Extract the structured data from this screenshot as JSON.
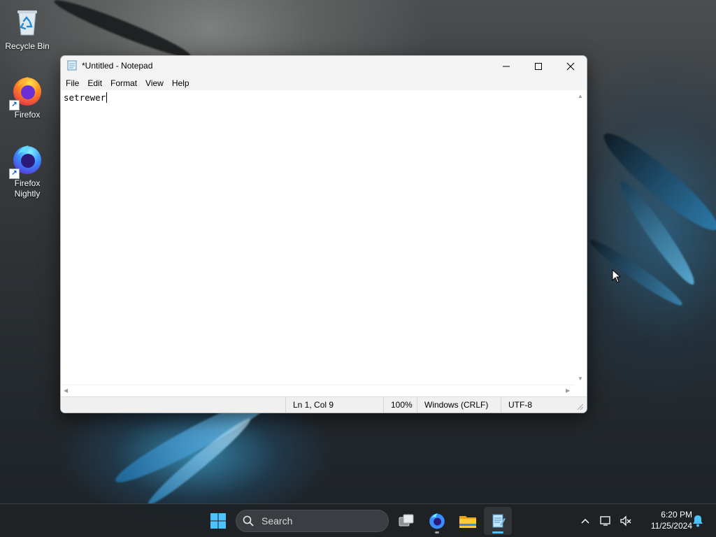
{
  "desktop": {
    "icons": [
      {
        "label": "Recycle Bin",
        "icon": "recycle-bin-icon"
      },
      {
        "label": "Firefox",
        "icon": "firefox-icon"
      },
      {
        "label": "Firefox Nightly",
        "icon": "firefox-nightly-icon"
      }
    ]
  },
  "notepad": {
    "title": "*Untitled - Notepad",
    "menu": [
      "File",
      "Edit",
      "Format",
      "View",
      "Help"
    ],
    "content": "setrewer",
    "status": {
      "position": "Ln 1, Col 9",
      "zoom": "100%",
      "line_endings": "Windows (CRLF)",
      "encoding": "UTF-8"
    }
  },
  "taskbar": {
    "search_placeholder": "Search",
    "time": "6:20 PM",
    "date": "11/25/2024",
    "accent_color": "#4cc2ff"
  }
}
